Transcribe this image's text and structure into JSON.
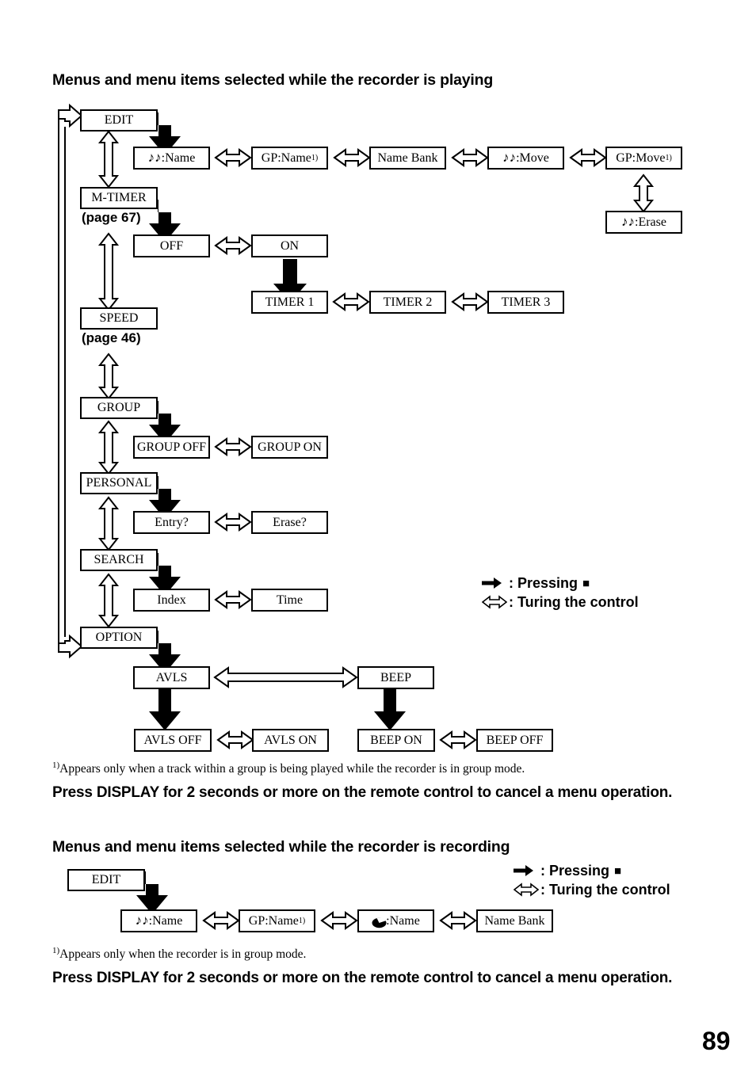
{
  "page_number": "89",
  "sections": {
    "playing": {
      "title": "Menus and menu items selected while the recorder is playing",
      "footnote": "Appears only when a track within a group is being played while the recorder is in group mode.",
      "footnote_marker": "1)",
      "cancel_note": "Press DISPLAY for 2 seconds or more on the remote control to cancel a menu operation.",
      "legend": {
        "press_icon": "solid-right-arrow-icon",
        "press_label": ": Pressing",
        "press_symbol": "■",
        "turn_icon": "hollow-double-arrow-icon",
        "turn_label": ": Turing the control"
      },
      "menu_column": [
        {
          "label": "EDIT",
          "page_ref": ""
        },
        {
          "label": "M-TIMER",
          "page_ref": "(page 67)"
        },
        {
          "label": "SPEED",
          "page_ref": "(page 46)"
        },
        {
          "label": "GROUP",
          "page_ref": ""
        },
        {
          "label": "PERSONAL",
          "page_ref": ""
        },
        {
          "label": "SEARCH",
          "page_ref": ""
        },
        {
          "label": "OPTION",
          "page_ref": ""
        }
      ],
      "rows": {
        "edit_items": [
          {
            "icon": "music-note-icon",
            "label": ":Name",
            "sup": ""
          },
          {
            "icon": "",
            "label": "GP:Name",
            "sup": "1)"
          },
          {
            "icon": "",
            "label": "Name Bank",
            "sup": ""
          },
          {
            "icon": "music-note-icon",
            "label": ":Move",
            "sup": ""
          },
          {
            "icon": "",
            "label": "GP:Move",
            "sup": "1)"
          }
        ],
        "erase_item": {
          "icon": "music-note-icon",
          "label": ":Erase",
          "sup": ""
        },
        "mtimer_items": [
          {
            "label": "OFF"
          },
          {
            "label": "ON"
          }
        ],
        "timer_items": [
          {
            "label": "TIMER 1"
          },
          {
            "label": "TIMER 2"
          },
          {
            "label": "TIMER 3"
          }
        ],
        "group_items": [
          {
            "label": "GROUP OFF"
          },
          {
            "label": "GROUP ON"
          }
        ],
        "personal_items": [
          {
            "label": "Entry?"
          },
          {
            "label": "Erase?"
          }
        ],
        "search_items": [
          {
            "label": "Index"
          },
          {
            "label": "Time"
          }
        ],
        "option_items": [
          {
            "label": "AVLS"
          },
          {
            "label": "BEEP"
          }
        ],
        "avls_items": [
          {
            "label": "AVLS OFF"
          },
          {
            "label": "AVLS ON"
          }
        ],
        "beep_items": [
          {
            "label": "BEEP ON"
          },
          {
            "label": "BEEP OFF"
          }
        ]
      }
    },
    "recording": {
      "title": "Menus and menu items selected while the recorder is recording",
      "footnote": "Appears only when the recorder is in group mode.",
      "footnote_marker": "1)",
      "cancel_note": "Press DISPLAY for 2 seconds or more on the remote control to cancel a menu operation.",
      "legend": {
        "press_icon": "solid-right-arrow-icon",
        "press_label": ": Pressing",
        "press_symbol": "■",
        "turn_icon": "hollow-double-arrow-icon",
        "turn_label": ": Turing the control"
      },
      "menu_column": [
        {
          "label": "EDIT"
        }
      ],
      "edit_items": [
        {
          "icon": "music-note-icon",
          "label": ":Name",
          "sup": ""
        },
        {
          "icon": "",
          "label": "GP:Name",
          "sup": "1)"
        },
        {
          "icon": "disc-icon",
          "label": ":Name",
          "sup": ""
        },
        {
          "icon": "",
          "label": "Name Bank",
          "sup": ""
        }
      ]
    }
  },
  "colors": {
    "ink": "#000000",
    "paper": "#ffffff"
  }
}
